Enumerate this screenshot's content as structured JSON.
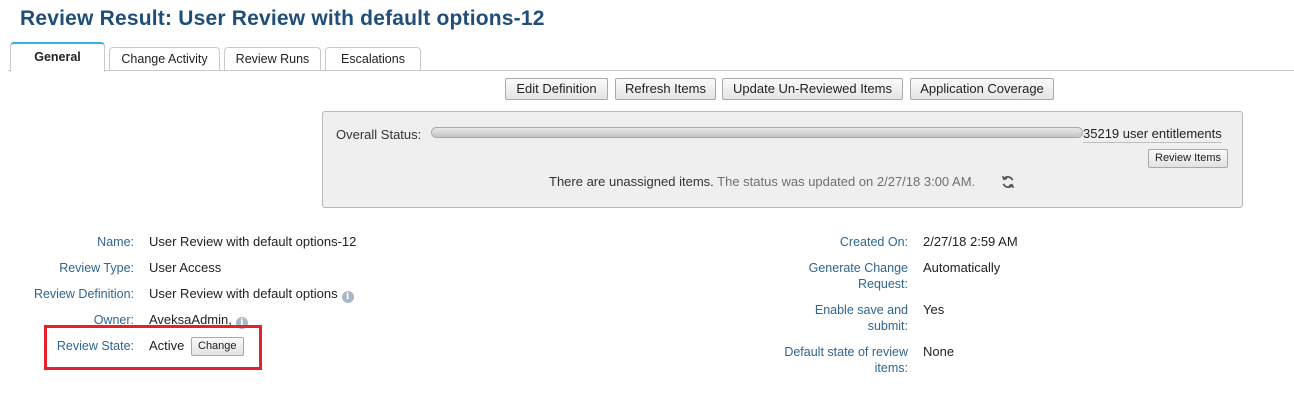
{
  "title": "Review Result: User Review with default options-12",
  "tabs": [
    {
      "label": "General",
      "active": true
    },
    {
      "label": "Change Activity",
      "active": false
    },
    {
      "label": "Review Runs",
      "active": false
    },
    {
      "label": "Escalations",
      "active": false
    }
  ],
  "toolbar": {
    "edit_definition": "Edit Definition",
    "refresh_items": "Refresh Items",
    "update_unreviewed": "Update Un-Reviewed Items",
    "application_coverage": "Application Coverage"
  },
  "status": {
    "label": "Overall Status:",
    "progress_fraction": 1.0,
    "entitlements": "35219 user entitlements",
    "review_items_button": "Review Items",
    "message_main": "There are unassigned items.",
    "message_updated": "The status was updated on 2/27/18 3:00 AM."
  },
  "details_left": {
    "name_label": "Name:",
    "name_value": "User Review with default options-12",
    "type_label": "Review Type:",
    "type_value": "User Access",
    "definition_label": "Review Definition:",
    "definition_value": "User Review with default options",
    "owner_label": "Owner:",
    "owner_value": "AveksaAdmin,",
    "state_label": "Review State:",
    "state_value": "Active",
    "change_button": "Change"
  },
  "details_right": {
    "created_label": "Created On:",
    "created_value": "2/27/18 2:59 AM",
    "gen_change_label": "Generate Change Request:",
    "gen_change_value": "Automatically",
    "enable_save_label": "Enable save and submit:",
    "enable_save_value": "Yes",
    "default_state_label": "Default state of review items:",
    "default_state_value": "None"
  },
  "icons": {
    "info": "info-icon",
    "refresh": "refresh-icon"
  },
  "colors": {
    "title": "#1f4e79",
    "label": "#2e6591",
    "active_tab_accent": "#37b3e3",
    "highlight": "#e8202a"
  }
}
